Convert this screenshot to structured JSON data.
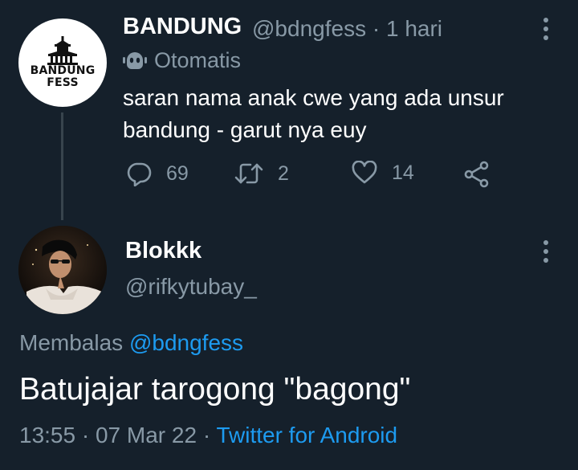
{
  "tweet": {
    "author_name": "BANDUNG",
    "author_handle": "@bdngfess",
    "separator": "·",
    "time_ago": "1 hari",
    "avatar_logo_line1": "BANDUNG",
    "avatar_logo_line2": "FESS",
    "automated_label": "Otomatis",
    "text": "saran nama anak cwe yang ada unsur bandung - garut nya euy",
    "reply_count": "69",
    "retweet_count": "2",
    "like_count": "14"
  },
  "reply": {
    "author_name": "Blokkk",
    "author_handle": "@rifkytubay_",
    "replying_prefix": "Membalas",
    "replying_to": "@bdngfess",
    "text": "Batujajar tarogong \"bagong\"",
    "time": "13:55",
    "date": "07 Mar 22",
    "separator": "·",
    "source": "Twitter for Android"
  },
  "icons": {
    "automated": "robot-icon",
    "reply": "reply-icon",
    "retweet": "retweet-icon",
    "like": "heart-icon",
    "share": "share-icon",
    "menu": "more-vertical-icon"
  },
  "colors": {
    "background": "#15202b",
    "text": "#ffffff",
    "secondary_text": "#8899a6",
    "link": "#1d9bf0",
    "thread_line": "#38444d"
  }
}
